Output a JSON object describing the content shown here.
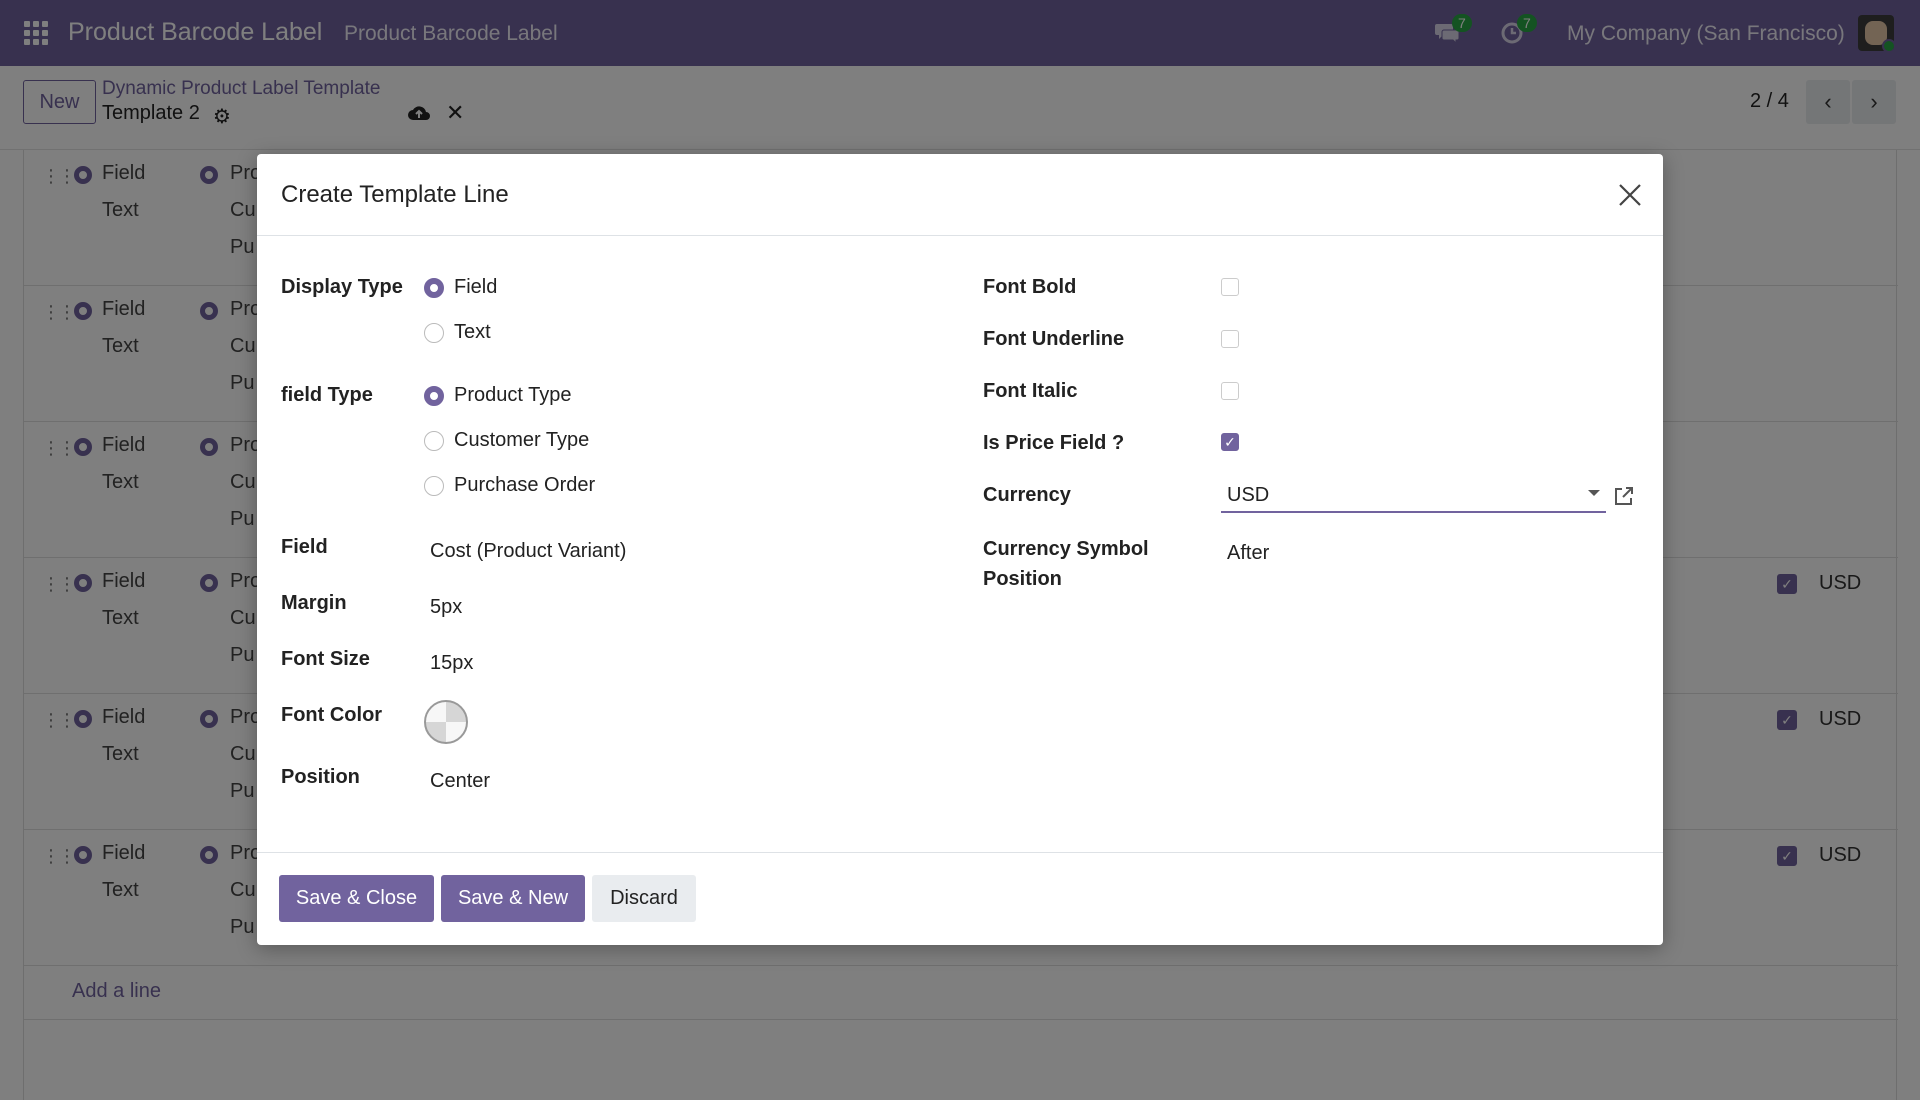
{
  "navbar": {
    "app_title": "Product Barcode Label",
    "menu_item": "Product Barcode Label",
    "messages_count": "7",
    "activities_count": "7",
    "company": "My Company (San Francisco)"
  },
  "control": {
    "new_label": "New",
    "breadcrumb": "Dynamic Product Label Template",
    "record_name": "Template 2",
    "pager": "2 / 4"
  },
  "list": {
    "rows": [
      {
        "type_a": "Field",
        "type_b": "Text",
        "col2_a": "Pro",
        "col2_b": "Cu",
        "col2_c": "Pu",
        "price": false,
        "currency": ""
      },
      {
        "type_a": "Field",
        "type_b": "Text",
        "col2_a": "Pro",
        "col2_b": "Cu",
        "col2_c": "Pu",
        "price": false,
        "currency": ""
      },
      {
        "type_a": "Field",
        "type_b": "Text",
        "col2_a": "Pro",
        "col2_b": "Cu",
        "col2_c": "Pu",
        "price": false,
        "currency": ""
      },
      {
        "type_a": "Field",
        "type_b": "Text",
        "col2_a": "Pro",
        "col2_b": "Cu",
        "col2_c": "Pu",
        "price": true,
        "currency": "USD"
      },
      {
        "type_a": "Field",
        "type_b": "Text",
        "col2_a": "Pro",
        "col2_b": "Cu",
        "col2_c": "Pu",
        "price": true,
        "currency": "USD"
      },
      {
        "type_a": "Field",
        "type_b": "Text",
        "col2_a": "Pro",
        "col2_b": "Cu",
        "col2_c": "Pu",
        "price": true,
        "currency": "USD"
      }
    ],
    "add_line": "Add a line"
  },
  "modal": {
    "title": "Create Template Line",
    "display_type": {
      "label": "Display Type",
      "options": [
        "Field",
        "Text"
      ],
      "selected": "Field"
    },
    "field_type": {
      "label": "field Type",
      "options": [
        "Product Type",
        "Customer Type",
        "Purchase Order"
      ],
      "selected": "Product Type"
    },
    "field": {
      "label": "Field",
      "value": "Cost (Product Variant)"
    },
    "margin": {
      "label": "Margin",
      "value": "5px"
    },
    "font_size": {
      "label": "Font Size",
      "value": "15px"
    },
    "font_color": {
      "label": "Font Color"
    },
    "position": {
      "label": "Position",
      "value": "Center"
    },
    "font_bold": {
      "label": "Font Bold",
      "checked": false
    },
    "font_underline": {
      "label": "Font Underline",
      "checked": false
    },
    "font_italic": {
      "label": "Font Italic",
      "checked": false
    },
    "is_price_field": {
      "label": "Is Price Field ?",
      "checked": true
    },
    "currency": {
      "label": "Currency",
      "value": "USD"
    },
    "currency_symbol_position": {
      "label_1": "Currency Symbol",
      "label_2": "Position",
      "value": "After"
    },
    "buttons": {
      "save_close": "Save & Close",
      "save_new": "Save & New",
      "discard": "Discard"
    }
  },
  "colors": {
    "accent": "#71639e",
    "badge": "#28a745"
  }
}
